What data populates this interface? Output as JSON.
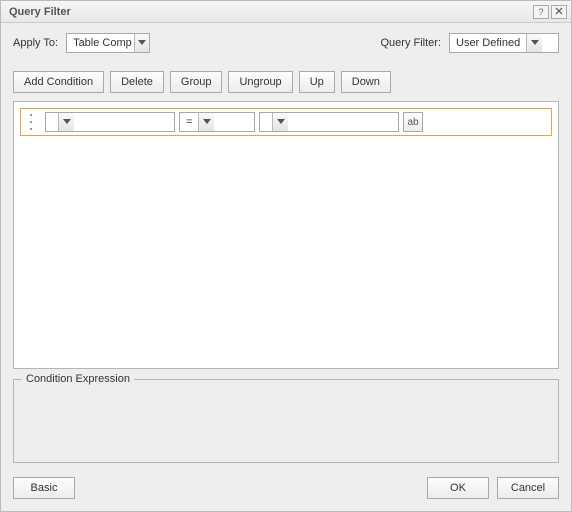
{
  "title": "Query Filter",
  "top": {
    "apply_label": "Apply To:",
    "apply_value": "Table Comp",
    "filter_label": "Query Filter:",
    "filter_value": "User Defined"
  },
  "toolbar": {
    "add": "Add Condition",
    "delete": "Delete",
    "group": "Group",
    "ungroup": "Ungroup",
    "up": "Up",
    "down": "Down"
  },
  "row": {
    "field": "",
    "op": "=",
    "value": "",
    "type_icon": "ab"
  },
  "expression": {
    "legend": "Condition Expression"
  },
  "footer": {
    "basic": "Basic",
    "ok": "OK",
    "cancel": "Cancel"
  }
}
